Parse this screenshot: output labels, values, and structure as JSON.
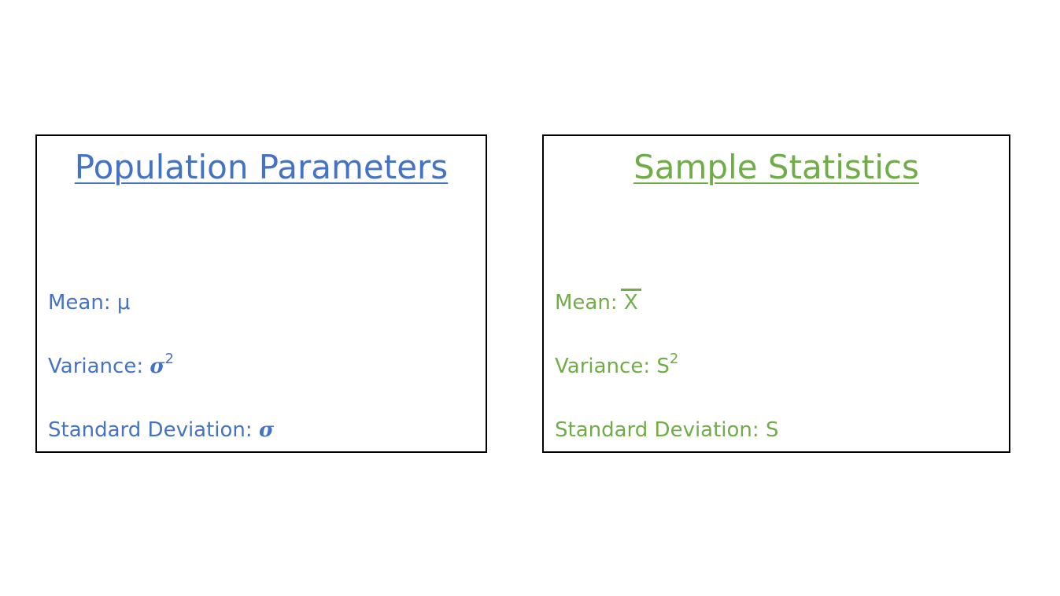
{
  "colors": {
    "population": "#4472C4",
    "sample": "#70AD47",
    "border": "#000000"
  },
  "population": {
    "title": "Population Parameters",
    "mean_label": "Mean: ",
    "mean_symbol": "μ",
    "variance_label": "Variance: ",
    "variance_symbol": "σ",
    "variance_exponent": "2",
    "sd_label": "Standard Deviation: ",
    "sd_symbol": "σ"
  },
  "sample": {
    "title": "Sample Statistics",
    "mean_label": "Mean: ",
    "mean_symbol": "X",
    "variance_label": "Variance: ",
    "variance_symbol": "S",
    "variance_exponent": "2",
    "sd_label": "Standard Deviation: ",
    "sd_symbol": "S"
  }
}
